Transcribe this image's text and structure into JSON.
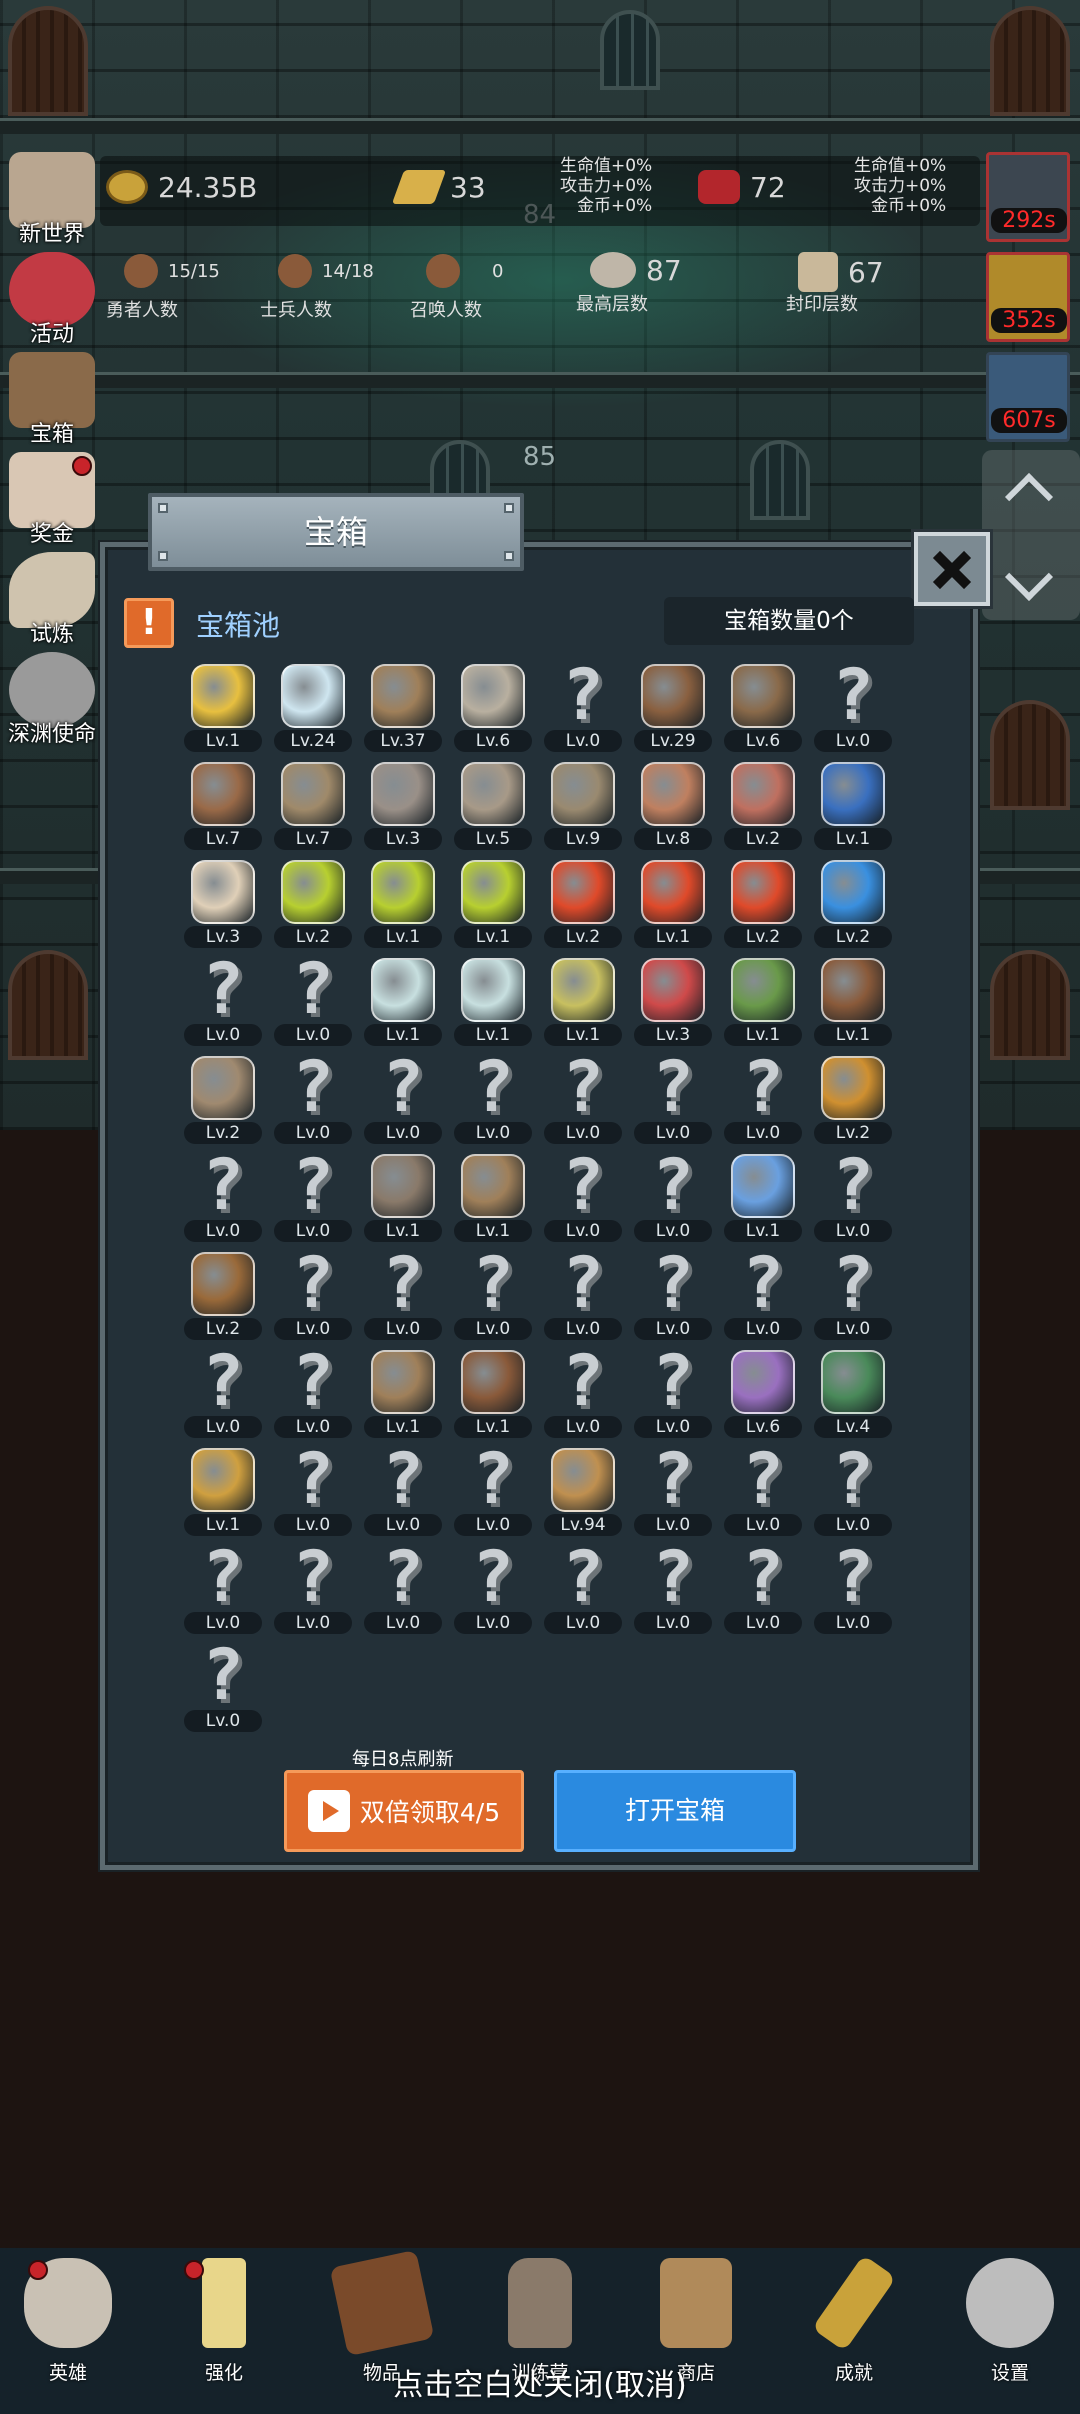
{
  "floors": {
    "upper": "84",
    "lower": "85"
  },
  "resources": {
    "gold": "24.35B",
    "bars": "33",
    "meat": "72",
    "stat_left": [
      "生命值+0%",
      "攻击力+0%",
      "金币+0%"
    ],
    "stat_right": [
      "生命值+0%",
      "攻击力+0%",
      "金币+0%"
    ]
  },
  "counts": {
    "heroes": {
      "value": "15/15",
      "label": "勇者人数"
    },
    "soldiers": {
      "value": "14/18",
      "label": "士兵人数"
    },
    "summons": {
      "value": "0",
      "label": "召唤人数"
    },
    "highest": {
      "value": "87",
      "label": "最高层数"
    },
    "sealed": {
      "value": "67",
      "label": "封印层数"
    }
  },
  "side_menu": [
    "新世界",
    "活动",
    "宝箱",
    "奖金",
    "试炼",
    "深渊使命"
  ],
  "timers": [
    "292s",
    "352s",
    "607s"
  ],
  "dialog": {
    "title": "宝箱",
    "pool_title": "宝箱池",
    "count_label": "宝箱数量0个",
    "refresh_note": "每日8点刷新",
    "video_button": "双倍领取4/5",
    "open_button": "打开宝箱"
  },
  "items": [
    {
      "icon": "crown-icon",
      "lv": "Lv.1"
    },
    {
      "icon": "diamond-icon",
      "lv": "Lv.24"
    },
    {
      "icon": "wooden-sword-icon",
      "lv": "Lv.37"
    },
    {
      "icon": "iron-sword-icon",
      "lv": "Lv.6"
    },
    {
      "icon": "unknown-item-icon",
      "lv": "Lv.0"
    },
    {
      "icon": "leather-armor-icon",
      "lv": "Lv.29"
    },
    {
      "icon": "backpack-icon",
      "lv": "Lv.6"
    },
    {
      "icon": "unknown-item-icon",
      "lv": "Lv.0"
    },
    {
      "icon": "leather-helmet-icon",
      "lv": "Lv.7"
    },
    {
      "icon": "dagger-icon",
      "lv": "Lv.7"
    },
    {
      "icon": "knight-helmet-icon",
      "lv": "Lv.3"
    },
    {
      "icon": "hammer-icon",
      "lv": "Lv.5"
    },
    {
      "icon": "great-helm-icon",
      "lv": "Lv.9"
    },
    {
      "icon": "ham-icon",
      "lv": "Lv.8"
    },
    {
      "icon": "steak-icon",
      "lv": "Lv.2"
    },
    {
      "icon": "blue-pouch-icon",
      "lv": "Lv.1"
    },
    {
      "icon": "bread-icon",
      "lv": "Lv.3"
    },
    {
      "icon": "yellow-potion-icon",
      "lv": "Lv.2"
    },
    {
      "icon": "yellow-potion-icon",
      "lv": "Lv.1"
    },
    {
      "icon": "yellow-potion-icon",
      "lv": "Lv.1"
    },
    {
      "icon": "red-potion-icon",
      "lv": "Lv.2"
    },
    {
      "icon": "red-potion-icon",
      "lv": "Lv.1"
    },
    {
      "icon": "red-potion-icon",
      "lv": "Lv.2"
    },
    {
      "icon": "blue-potion-icon",
      "lv": "Lv.2"
    },
    {
      "icon": "unknown-item-icon",
      "lv": "Lv.0"
    },
    {
      "icon": "unknown-item-icon",
      "lv": "Lv.0"
    },
    {
      "icon": "white-vial-icon",
      "lv": "Lv.1"
    },
    {
      "icon": "white-vial-icon",
      "lv": "Lv.1"
    },
    {
      "icon": "yellow-vial-icon",
      "lv": "Lv.1"
    },
    {
      "icon": "red-vial-icon",
      "lv": "Lv.3"
    },
    {
      "icon": "winged-boot-icon",
      "lv": "Lv.1"
    },
    {
      "icon": "leather-boot-icon",
      "lv": "Lv.1"
    },
    {
      "icon": "cloth-boot-icon",
      "lv": "Lv.2"
    },
    {
      "icon": "unknown-item-icon",
      "lv": "Lv.0"
    },
    {
      "icon": "unknown-item-icon",
      "lv": "Lv.0"
    },
    {
      "icon": "unknown-item-icon",
      "lv": "Lv.0"
    },
    {
      "icon": "unknown-item-icon",
      "lv": "Lv.0"
    },
    {
      "icon": "unknown-item-icon",
      "lv": "Lv.0"
    },
    {
      "icon": "unknown-item-icon",
      "lv": "Lv.0"
    },
    {
      "icon": "torch-icon",
      "lv": "Lv.2"
    },
    {
      "icon": "unknown-item-icon",
      "lv": "Lv.0"
    },
    {
      "icon": "unknown-item-icon",
      "lv": "Lv.0"
    },
    {
      "icon": "pickaxe-icon",
      "lv": "Lv.1"
    },
    {
      "icon": "staff-icon",
      "lv": "Lv.1"
    },
    {
      "icon": "unknown-item-icon",
      "lv": "Lv.0"
    },
    {
      "icon": "unknown-item-icon",
      "lv": "Lv.0"
    },
    {
      "icon": "magic-wand-icon",
      "lv": "Lv.1"
    },
    {
      "icon": "unknown-item-icon",
      "lv": "Lv.0"
    },
    {
      "icon": "large-backpack-icon",
      "lv": "Lv.2"
    },
    {
      "icon": "unknown-item-icon",
      "lv": "Lv.0"
    },
    {
      "icon": "unknown-item-icon",
      "lv": "Lv.0"
    },
    {
      "icon": "unknown-item-icon",
      "lv": "Lv.0"
    },
    {
      "icon": "unknown-item-icon",
      "lv": "Lv.0"
    },
    {
      "icon": "unknown-item-icon",
      "lv": "Lv.0"
    },
    {
      "icon": "unknown-item-icon",
      "lv": "Lv.0"
    },
    {
      "icon": "unknown-item-icon",
      "lv": "Lv.0"
    },
    {
      "icon": "unknown-item-icon",
      "lv": "Lv.0"
    },
    {
      "icon": "unknown-item-icon",
      "lv": "Lv.0"
    },
    {
      "icon": "bow-icon",
      "lv": "Lv.1"
    },
    {
      "icon": "quiver-icon",
      "lv": "Lv.1"
    },
    {
      "icon": "unknown-item-icon",
      "lv": "Lv.0"
    },
    {
      "icon": "unknown-item-icon",
      "lv": "Lv.0"
    },
    {
      "icon": "tentacle-monster-icon",
      "lv": "Lv.6"
    },
    {
      "icon": "emblem-shield-icon",
      "lv": "Lv.4"
    },
    {
      "icon": "ornate-scepter-icon",
      "lv": "Lv.1"
    },
    {
      "icon": "unknown-item-icon",
      "lv": "Lv.0"
    },
    {
      "icon": "unknown-item-icon",
      "lv": "Lv.0"
    },
    {
      "icon": "unknown-item-icon",
      "lv": "Lv.0"
    },
    {
      "icon": "beer-mug-icon",
      "lv": "Lv.94"
    },
    {
      "icon": "unknown-item-icon",
      "lv": "Lv.0"
    },
    {
      "icon": "unknown-item-icon",
      "lv": "Lv.0"
    },
    {
      "icon": "unknown-item-icon",
      "lv": "Lv.0"
    },
    {
      "icon": "unknown-item-icon",
      "lv": "Lv.0"
    },
    {
      "icon": "unknown-item-icon",
      "lv": "Lv.0"
    },
    {
      "icon": "unknown-item-icon",
      "lv": "Lv.0"
    },
    {
      "icon": "unknown-item-icon",
      "lv": "Lv.0"
    },
    {
      "icon": "unknown-item-icon",
      "lv": "Lv.0"
    },
    {
      "icon": "unknown-item-icon",
      "lv": "Lv.0"
    },
    {
      "icon": "unknown-item-icon",
      "lv": "Lv.0"
    },
    {
      "icon": "unknown-item-icon",
      "lv": "Lv.0"
    },
    {
      "icon": "unknown-item-icon",
      "lv": "Lv.0"
    }
  ],
  "bottom_nav": [
    "英雄",
    "强化",
    "物品",
    "训练营",
    "商店",
    "成就",
    "设置"
  ],
  "close_hint": "点击空白处关闭(取消)",
  "colors": {
    "accent_orange": "#e06a2a",
    "accent_blue": "#2a8ae0",
    "timer_red": "#ff2a2a",
    "panel_bg": "#233038"
  }
}
